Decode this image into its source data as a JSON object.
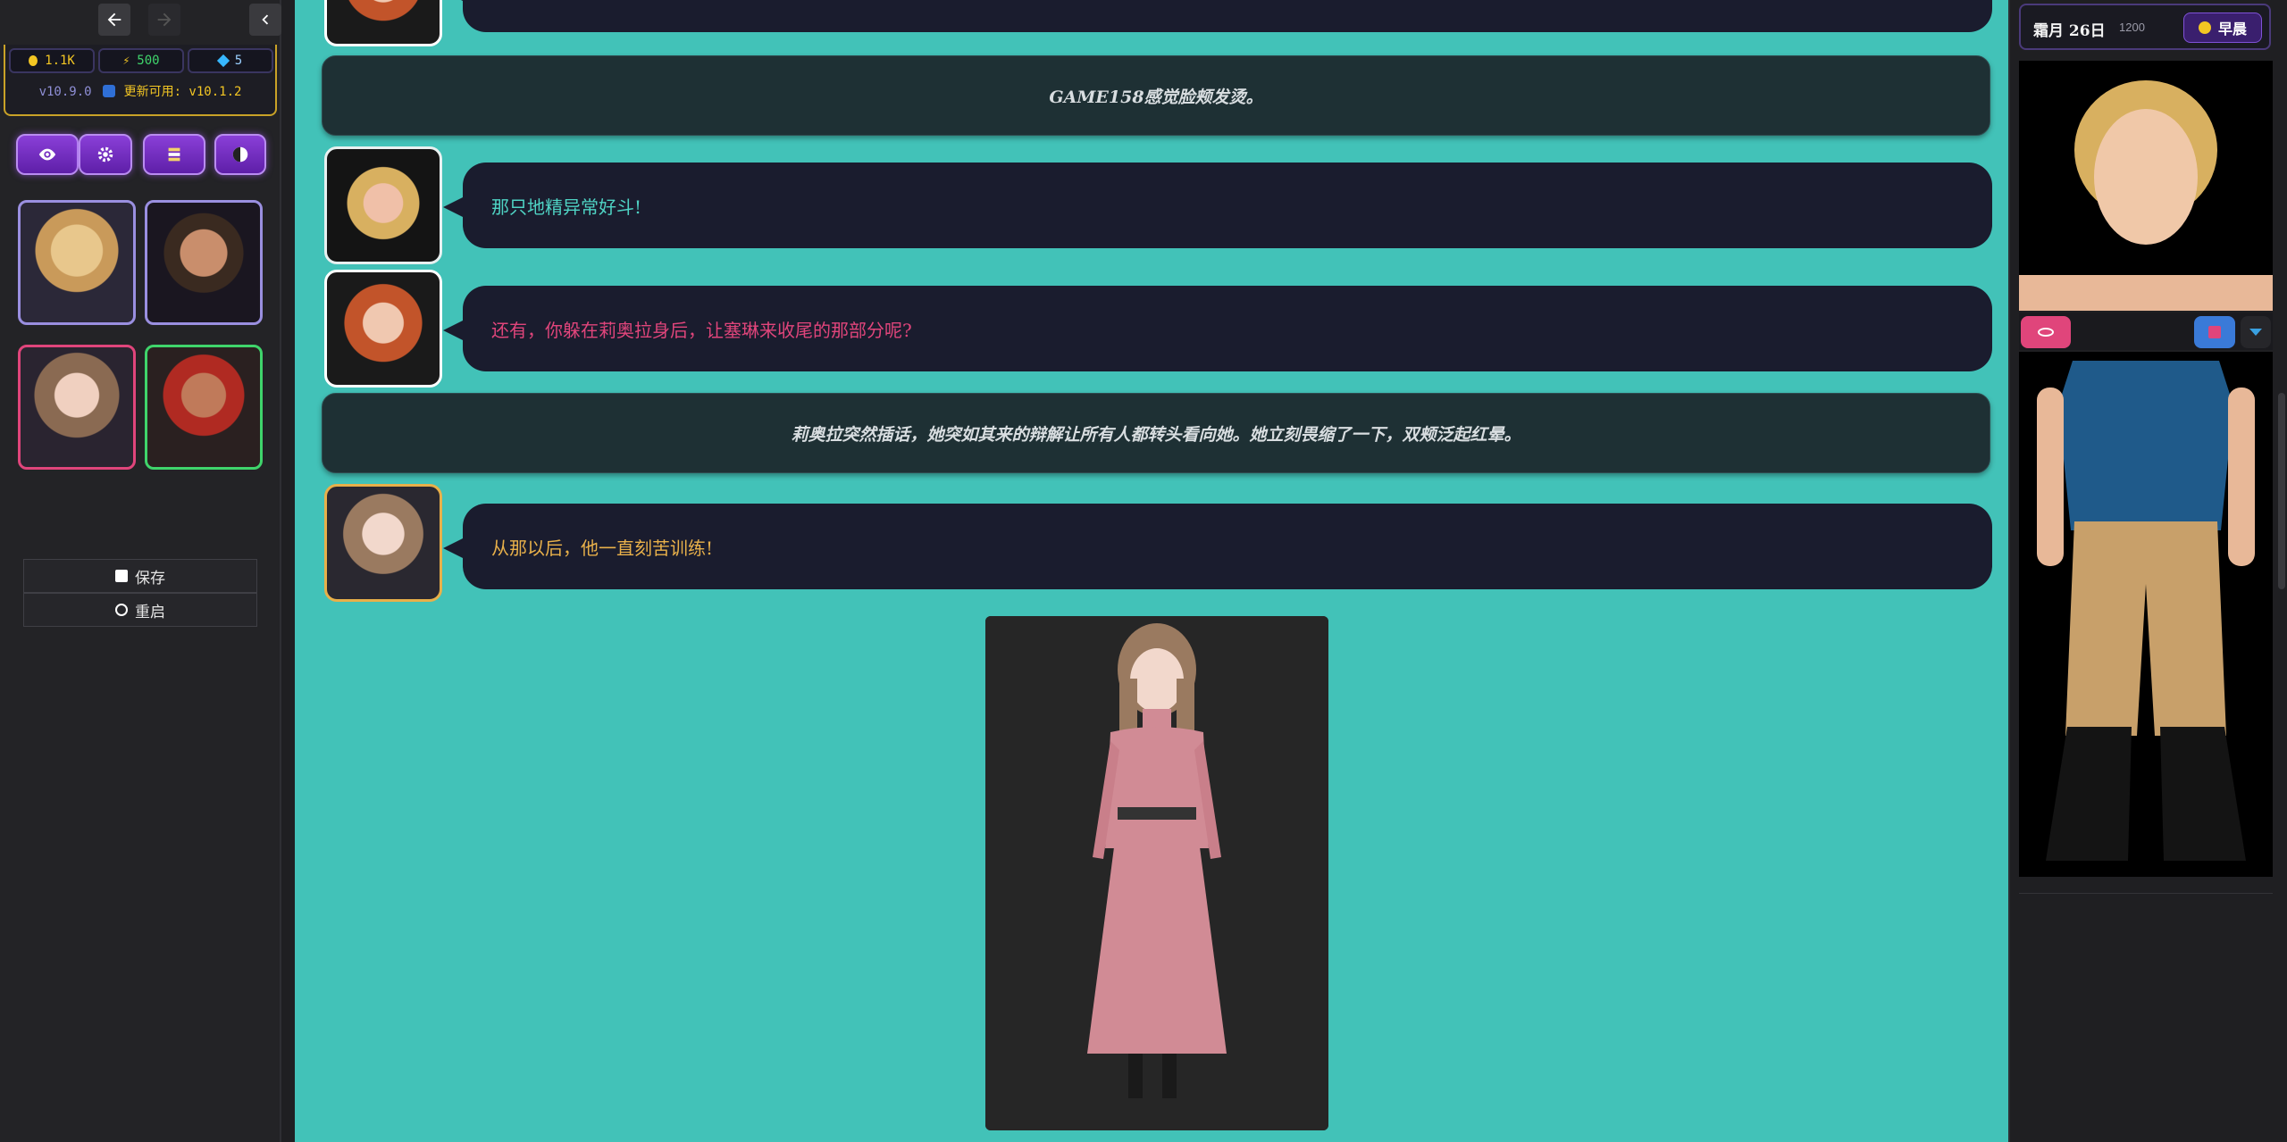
{
  "sidebar": {
    "stats": {
      "gold": "1.1K",
      "energy": "500",
      "gems": "5"
    },
    "version": {
      "current": "v10.9.0",
      "update": "更新可用: v10.1.2"
    },
    "menu": {
      "save": "保存",
      "restart": "重启"
    }
  },
  "chat": {
    "narration_top": "GAME158感觉脸颊发烫。",
    "msg1": "那只地精异常好斗!",
    "msg2": "还有，你躲在莉奥拉身后，让塞琳来收尾的那部分呢?",
    "narration2": "莉奥拉突然插话，她突如其来的辩解让所有人都转头看向她。她立刻畏缩了一下，双颊泛起红晕。",
    "msg3": "从那以后，他一直刻苦训练!"
  },
  "colors": {
    "msg1": "#4fd3c4",
    "msg2": "#e0457b",
    "msg3": "#e8b04a"
  },
  "status": {
    "date": "霜月 26日",
    "time": "1200",
    "time_of_day": "早晨"
  }
}
